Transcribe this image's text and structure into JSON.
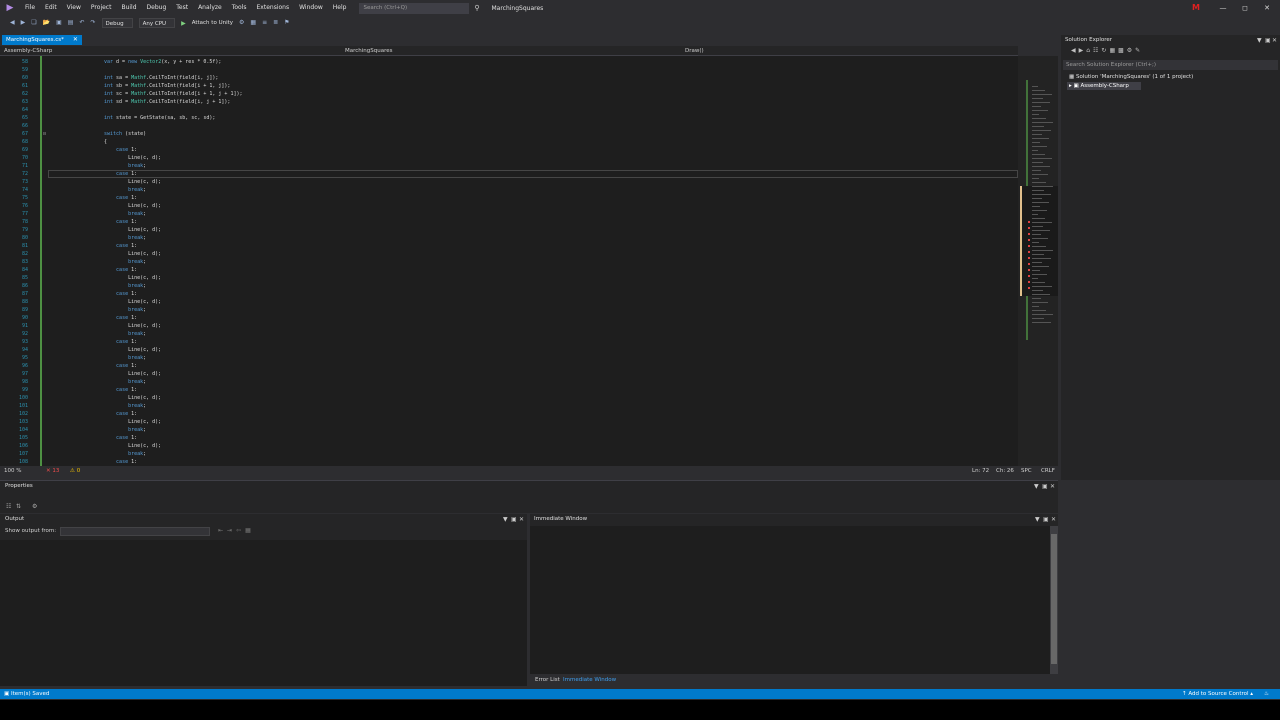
{
  "menu": {
    "items": [
      "File",
      "Edit",
      "View",
      "Project",
      "Build",
      "Debug",
      "Test",
      "Analyze",
      "Tools",
      "Extensions",
      "Window",
      "Help"
    ],
    "search_placeholder": "Search (Ctrl+Q)",
    "solution_name": "MarchingSquares",
    "user_initial": "M"
  },
  "toolbar": {
    "config": "Debug",
    "platform": "Any CPU",
    "attach_label": "Attach to Unity"
  },
  "document": {
    "tab_label": "MarchingSquares.cs*",
    "project_dropdown": "Assembly-CSharp",
    "class_dropdown": "MarchingSquares",
    "member_dropdown": "Draw()"
  },
  "editor": {
    "lines": [
      {
        "n": "58",
        "code": "var d = new Vector2(x, y + res * 0.5f);"
      },
      {
        "n": "59",
        "code": ""
      },
      {
        "n": "60",
        "code": "int sa = Mathf.CeilToInt(field[i, j]);"
      },
      {
        "n": "61",
        "code": "int sb = Mathf.CeilToInt(field[i + 1, j]);"
      },
      {
        "n": "62",
        "code": "int sc = Mathf.CeilToInt(field[i + 1, j + 1]);"
      },
      {
        "n": "63",
        "code": "int sd = Mathf.CeilToInt(field[i, j + 1]);"
      },
      {
        "n": "64",
        "code": ""
      },
      {
        "n": "65",
        "code": "int state = GetState(sa, sb, sc, sd);"
      },
      {
        "n": "66",
        "code": ""
      },
      {
        "n": "67",
        "code": "switch (state)"
      },
      {
        "n": "68",
        "code": "{"
      },
      {
        "n": "69",
        "code": "    case 1:"
      },
      {
        "n": "70",
        "code": "        Line(c, d);"
      },
      {
        "n": "71",
        "code": "        break;"
      },
      {
        "n": "72",
        "code": "    case 1:"
      },
      {
        "n": "73",
        "code": "        Line(c, d);"
      },
      {
        "n": "74",
        "code": "        break;"
      },
      {
        "n": "75",
        "code": "    case 1:"
      },
      {
        "n": "76",
        "code": "        Line(c, d);"
      },
      {
        "n": "77",
        "code": "        break;"
      },
      {
        "n": "78",
        "code": "    case 1:"
      },
      {
        "n": "79",
        "code": "        Line(c, d);"
      },
      {
        "n": "80",
        "code": "        break;"
      },
      {
        "n": "81",
        "code": "    case 1:"
      },
      {
        "n": "82",
        "code": "        Line(c, d);"
      },
      {
        "n": "83",
        "code": "        break;"
      },
      {
        "n": "84",
        "code": "    case 1:"
      },
      {
        "n": "85",
        "code": "        Line(c, d);"
      },
      {
        "n": "86",
        "code": "        break;"
      },
      {
        "n": "87",
        "code": "    case 1:"
      },
      {
        "n": "88",
        "code": "        Line(c, d);"
      },
      {
        "n": "89",
        "code": "        break;"
      },
      {
        "n": "90",
        "code": "    case 1:"
      },
      {
        "n": "91",
        "code": "        Line(c, d);"
      },
      {
        "n": "92",
        "code": "        break;"
      },
      {
        "n": "93",
        "code": "    case 1:"
      },
      {
        "n": "94",
        "code": "        Line(c, d);"
      },
      {
        "n": "95",
        "code": "        break;"
      },
      {
        "n": "96",
        "code": "    case 1:"
      },
      {
        "n": "97",
        "code": "        Line(c, d);"
      },
      {
        "n": "98",
        "code": "        break;"
      },
      {
        "n": "99",
        "code": "    case 1:"
      },
      {
        "n": "100",
        "code": "        Line(c, d);"
      },
      {
        "n": "101",
        "code": "        break;"
      },
      {
        "n": "102",
        "code": "    case 1:"
      },
      {
        "n": "103",
        "code": "        Line(c, d);"
      },
      {
        "n": "104",
        "code": "        break;"
      },
      {
        "n": "105",
        "code": "    case 1:"
      },
      {
        "n": "106",
        "code": "        Line(c, d);"
      },
      {
        "n": "107",
        "code": "        break;"
      },
      {
        "n": "108",
        "code": "    case 1:"
      }
    ],
    "zoom": "100 %",
    "errors": "13",
    "warnings": "0",
    "line_pos": "Ln: 72",
    "col_pos": "Ch: 26",
    "encoding": "SPC",
    "eol": "CRLF"
  },
  "solution_explorer": {
    "title": "Solution Explorer",
    "search_placeholder": "Search Solution Explorer (Ctrl+;)",
    "solution_item": "Solution 'MarchingSquares' (1 of 1 project)",
    "project_item": "Assembly-CSharp"
  },
  "properties": {
    "title": "Properties"
  },
  "output": {
    "title": "Output",
    "show_from_label": "Show output from:"
  },
  "immediate": {
    "title": "Immediate Window"
  },
  "bottom_tabs": [
    "Error List",
    "Immediate Window"
  ],
  "status": {
    "left": "Item(s) Saved",
    "right": "Add to Source Control"
  }
}
